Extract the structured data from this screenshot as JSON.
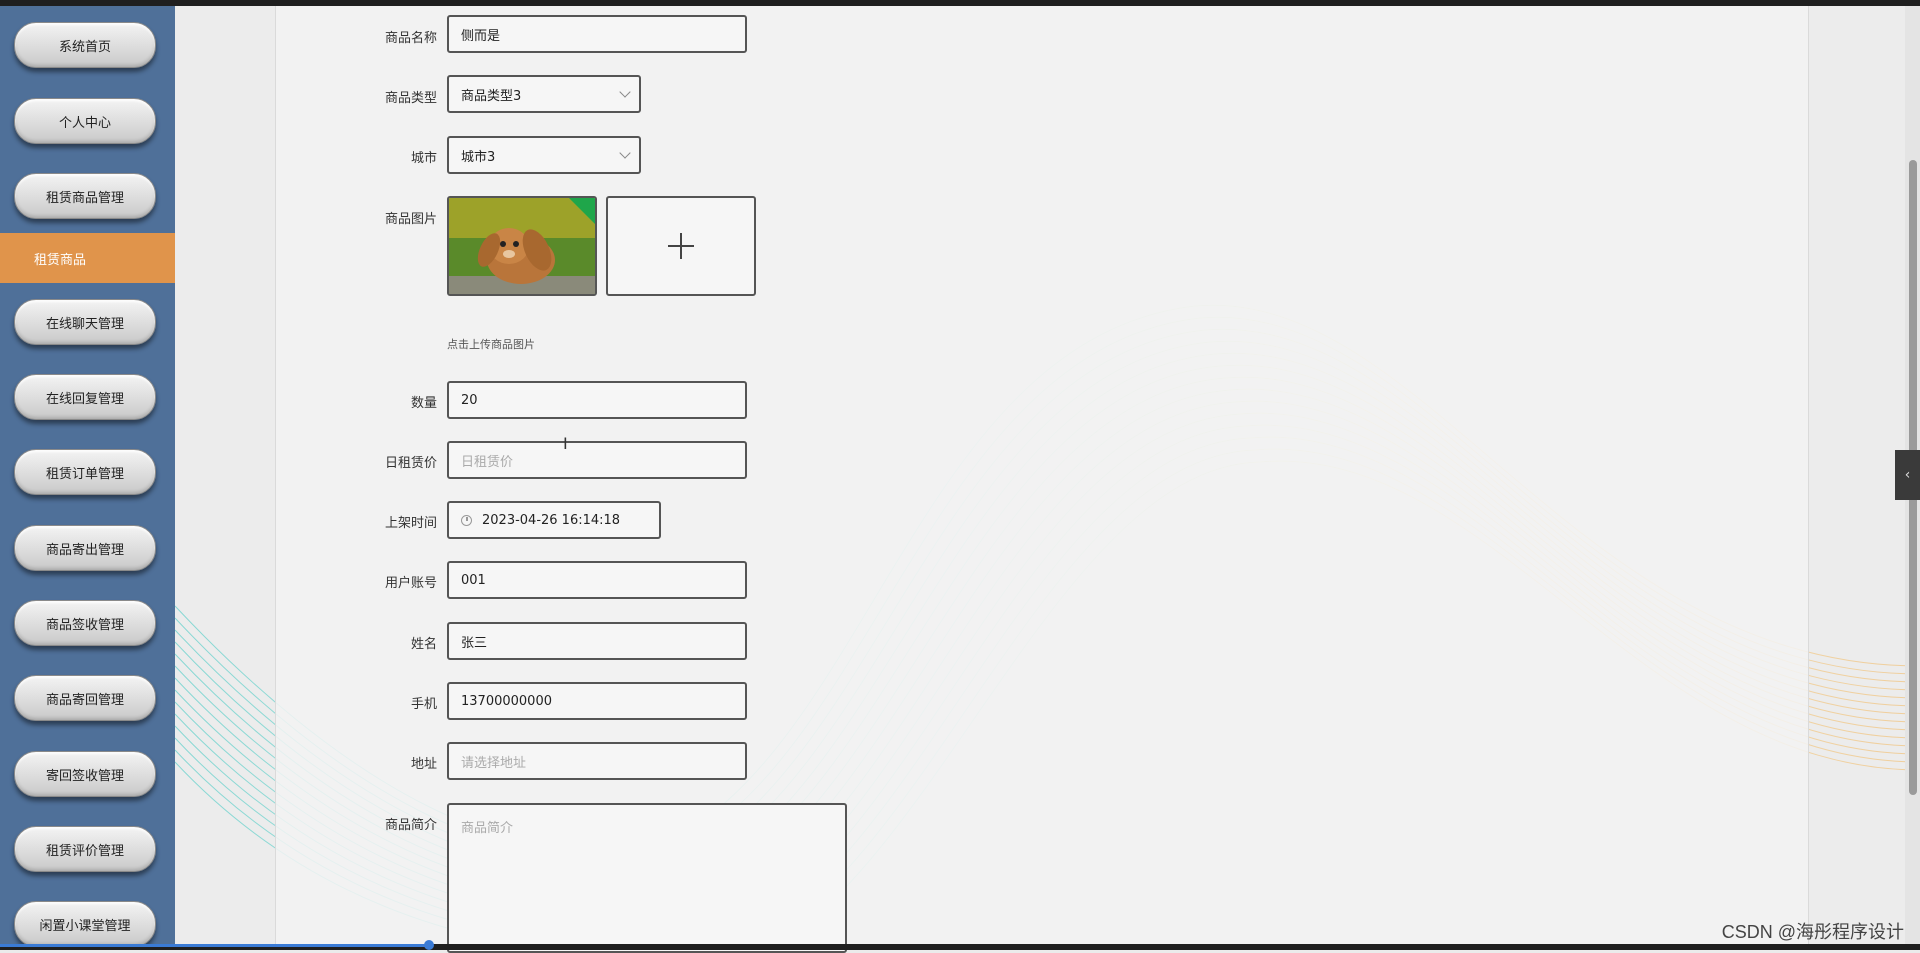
{
  "sidebar": {
    "items": [
      {
        "label": "系统首页"
      },
      {
        "label": "个人中心"
      },
      {
        "label": "租赁商品管理"
      },
      {
        "label": "租赁商品",
        "active": true
      },
      {
        "label": "在线聊天管理"
      },
      {
        "label": "在线回复管理"
      },
      {
        "label": "租赁订单管理"
      },
      {
        "label": "商品寄出管理"
      },
      {
        "label": "商品签收管理"
      },
      {
        "label": "商品寄回管理"
      },
      {
        "label": "寄回签收管理"
      },
      {
        "label": "租赁评价管理"
      },
      {
        "label": "闲置小课堂管理"
      }
    ],
    "active_color": "#e0944b",
    "bg_color": "#4f7099"
  },
  "form": {
    "name": {
      "label": "商品名称",
      "value": "侧而是"
    },
    "type": {
      "label": "商品类型",
      "value": "商品类型3"
    },
    "city": {
      "label": "城市",
      "value": "城市3"
    },
    "image": {
      "label": "商品图片",
      "hint": "点击上传商品图片",
      "thumbnail": "rabbit-photo"
    },
    "quantity": {
      "label": "数量",
      "value": "20"
    },
    "daily_price": {
      "label": "日租赁价",
      "placeholder": "日租赁价"
    },
    "listed_time": {
      "label": "上架时间",
      "value": "2023-04-26 16:14:18"
    },
    "account": {
      "label": "用户账号",
      "value": "001"
    },
    "real_name": {
      "label": "姓名",
      "value": "张三"
    },
    "phone": {
      "label": "手机",
      "value": "13700000000"
    },
    "address": {
      "label": "地址",
      "placeholder": "请选择地址"
    },
    "intro": {
      "label": "商品简介",
      "placeholder": "商品简介"
    }
  },
  "watermark": "CSDN @海彤程序设计"
}
